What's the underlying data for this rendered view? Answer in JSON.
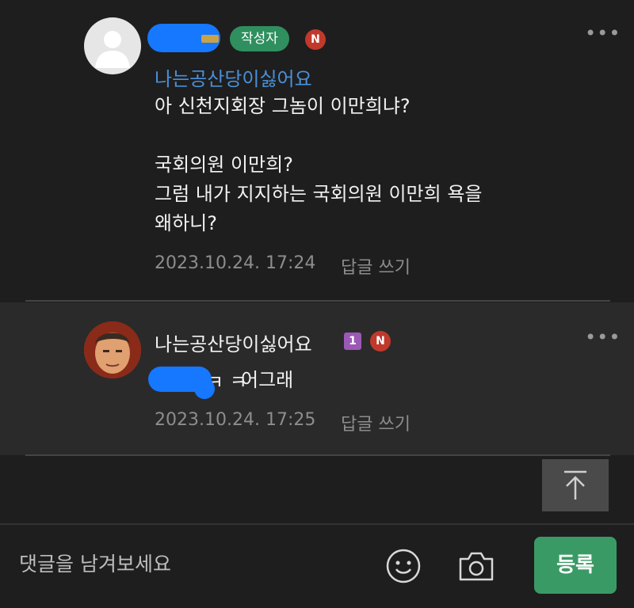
{
  "comments": [
    {
      "author_badge": "작성자",
      "n_badge": "N",
      "more": "•••",
      "mention": "나는공산당이싫어요",
      "lines": [
        "아 신천지회장 그놈이 이만희냐?",
        "",
        "국회의원 이만희?",
        "그럼 내가 지지하는 국회의원 이만희 욕을",
        "왜하니?"
      ],
      "timestamp": "2023.10.24. 17:24",
      "reply": "답글 쓰기"
    },
    {
      "author": "나는공산당이싫어요",
      "rank_badge": "1",
      "n_badge": "N",
      "more": "•••",
      "kk": "ㅋ ㅋ",
      "text": "어그래",
      "timestamp": "2023.10.24. 17:25",
      "reply": "답글 쓰기"
    }
  ],
  "composer": {
    "placeholder": "댓글을 남겨보세요",
    "submit_label": "등록",
    "icons": [
      "smiley-icon",
      "camera-icon"
    ]
  },
  "scroll_top_icon": "arrow-up-icon",
  "colors": {
    "background": "#1e1e1e",
    "reply_bg": "#2a2a2a",
    "accent_green": "#3a9a65",
    "mention_blue": "#4a90d9",
    "n_badge": "#c0392b"
  }
}
